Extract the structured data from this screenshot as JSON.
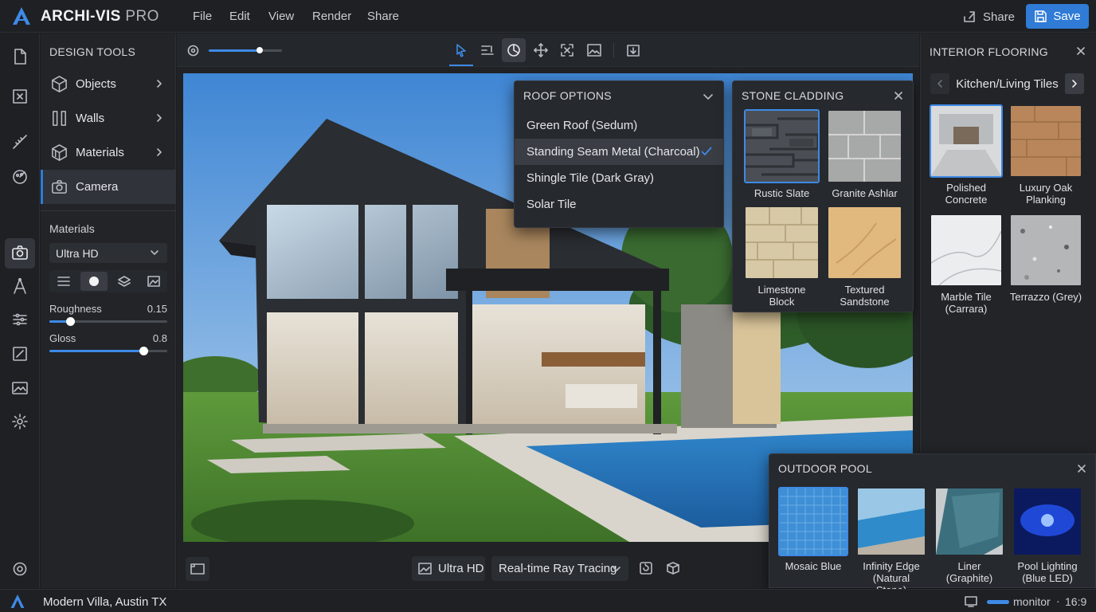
{
  "app": {
    "name": "ARCHI-VIS",
    "edition": "PRO"
  },
  "menu": [
    "File",
    "Edit",
    "View",
    "Render",
    "Share"
  ],
  "header": {
    "share_label": "Share",
    "save_label": "Save"
  },
  "design_tools": {
    "title": "DESIGN TOOLS",
    "items": [
      {
        "label": "Objects",
        "icon": "cube-icon"
      },
      {
        "label": "Walls",
        "icon": "walls-icon"
      },
      {
        "label": "Materials",
        "icon": "materials-icon"
      },
      {
        "label": "Camera",
        "icon": "camera-icon",
        "active": true
      }
    ]
  },
  "materials_panel": {
    "label": "Materials",
    "quality": "Ultra HD",
    "roughness": {
      "label": "Roughness",
      "value": "0.15"
    },
    "gloss": {
      "label": "Gloss",
      "value": "0.8"
    }
  },
  "viewport": {
    "zoom_level": 0.7,
    "bottom": {
      "quality": "Ultra HD",
      "render_mode": "Real-time Ray Tracing"
    }
  },
  "roof_options": {
    "title": "ROOF OPTIONS",
    "options": [
      {
        "label": "Green Roof (Sedum)"
      },
      {
        "label": "Standing Seam Metal (Charcoal)",
        "selected": true
      },
      {
        "label": "Shingle Tile (Dark Gray)"
      },
      {
        "label": "Solar Tile"
      }
    ]
  },
  "stone_cladding": {
    "title": "STONE CLADDING",
    "items": [
      {
        "label": "Rustic Slate",
        "selected": true
      },
      {
        "label": "Granite Ashlar"
      },
      {
        "label": "Limestone Block"
      },
      {
        "label": "Textured Sandstone"
      }
    ]
  },
  "interior_flooring": {
    "title": "INTERIOR FLOORING",
    "category": "Kitchen/Living Tiles",
    "items": [
      {
        "label": "Polished Concrete",
        "selected": true
      },
      {
        "label": "Luxury Oak Planking"
      },
      {
        "label": "Marble Tile (Carrara)"
      },
      {
        "label": "Terrazzo (Grey)"
      }
    ]
  },
  "outdoor_pool": {
    "title": "OUTDOOR POOL",
    "items": [
      {
        "label": "Mosaic Blue",
        "selected": true
      },
      {
        "label": "Infinity Edge (Natural Stone)"
      },
      {
        "label": "Liner (Graphite)"
      },
      {
        "label": "Pool Lighting (Blue LED)"
      }
    ]
  },
  "status": {
    "project": "Modern Villa, Austin TX",
    "monitor": "monitor",
    "separator": "·",
    "ratio": "16:9"
  },
  "colors": {
    "accent": "#2f7bd6",
    "panel": "#222428",
    "background": "#1b1d21"
  }
}
